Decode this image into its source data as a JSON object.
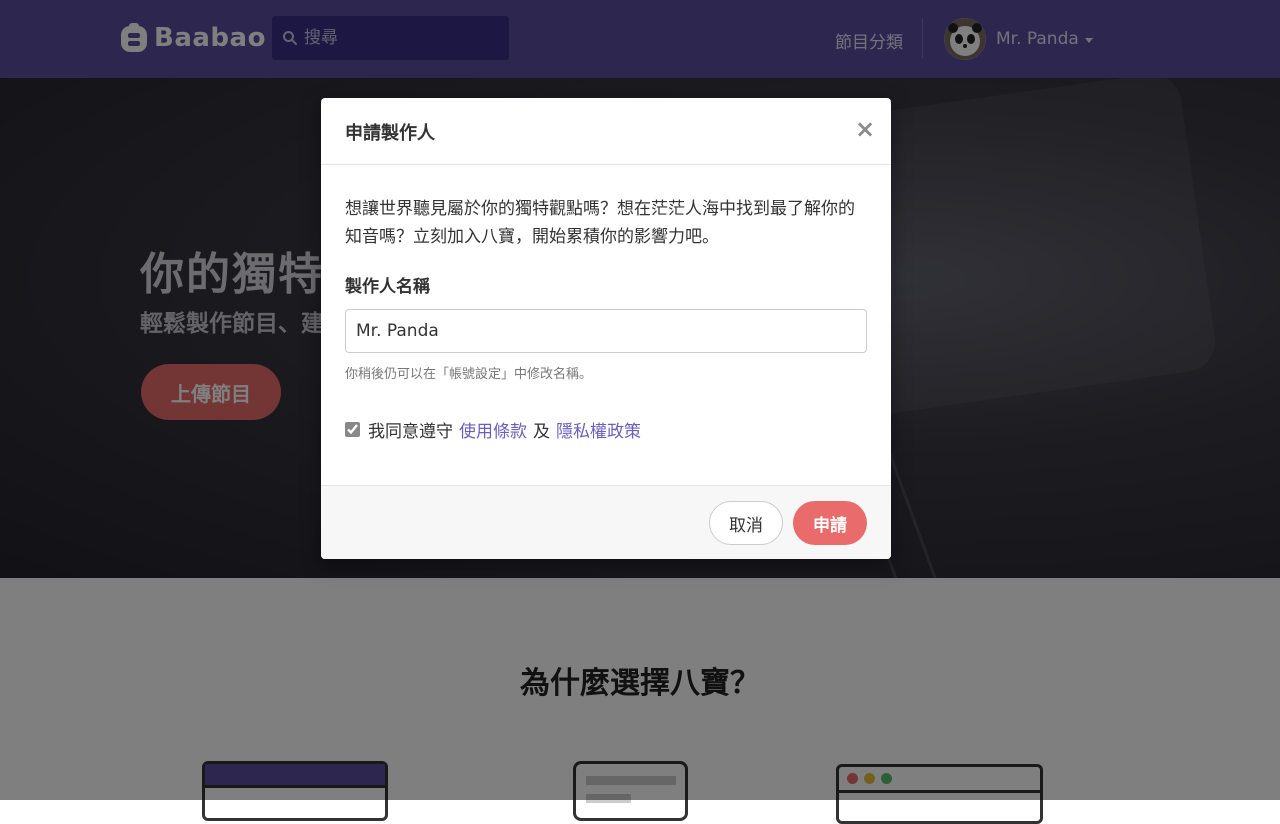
{
  "navbar": {
    "brand": "Baabao",
    "brand_icon": "baabao-logo-icon",
    "search_placeholder": "搜尋",
    "categories_link": "節目分類",
    "user_name": "Mr. Panda",
    "background_color": "#5b4f9e"
  },
  "hero": {
    "title": "你的獨特觀點",
    "subtitle": "輕鬆製作節目、建立",
    "upload_button": "上傳節目"
  },
  "features": {
    "title": "為什麼選擇八寶？"
  },
  "modal": {
    "title": "申請製作人",
    "close_icon": "×",
    "description": "想讓世界聽見屬於你的獨特觀點嗎？想在茫茫人海中找到最了解你的知音嗎？立刻加入八寶，開始累積你的影響力吧。",
    "producer_name_label": "製作人名稱",
    "producer_name_value": "Mr. Panda",
    "help_text": "你稍後仍可以在「帳號設定」中修改名稱。",
    "agree_prefix": "我同意遵守",
    "terms_link": "使用條款",
    "and_text": "及",
    "privacy_link": "隱私權政策",
    "agree_checked": true,
    "cancel_button": "取消",
    "submit_button": "申請",
    "accent_color": "#e96b6b",
    "link_color": "#6a5fbf"
  }
}
